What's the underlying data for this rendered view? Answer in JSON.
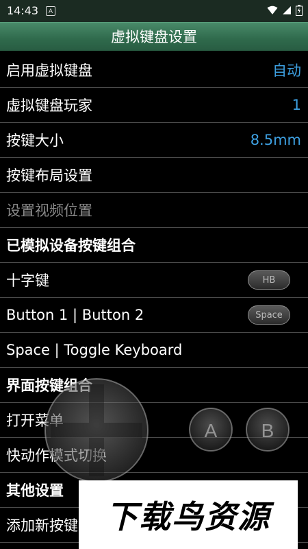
{
  "status": {
    "time": "14:43",
    "notif_glyph": "A",
    "icons": [
      "wifi-icon",
      "signal-icon",
      "battery-icon"
    ]
  },
  "title": "虚拟键盘设置",
  "rows": [
    {
      "label": "启用虚拟键盘",
      "value": "自动"
    },
    {
      "label": "虚拟键盘玩家",
      "value": "1"
    },
    {
      "label": "按键大小",
      "value": "8.5mm"
    },
    {
      "label": "按键布局设置"
    },
    {
      "label": "设置视频位置"
    },
    {
      "label": "已模拟设备按键组合"
    },
    {
      "label": "十字键",
      "pill": "HB"
    },
    {
      "label": "Button 1 | Button 2",
      "pill": "Space"
    },
    {
      "label": "Space | Toggle Keyboard"
    },
    {
      "label": "界面按键组合"
    },
    {
      "label": "打开菜单"
    },
    {
      "label": "快动作模式切换"
    },
    {
      "label": "其他设置"
    },
    {
      "label": "添加新按键组合"
    }
  ],
  "gamepad": {
    "button_a": "A",
    "button_b": "B"
  },
  "watermark": "下载鸟资源",
  "colors": {
    "accent": "#3d9fe0",
    "titlebar": "#2f6a4c",
    "divider": "#4a4a4a"
  }
}
